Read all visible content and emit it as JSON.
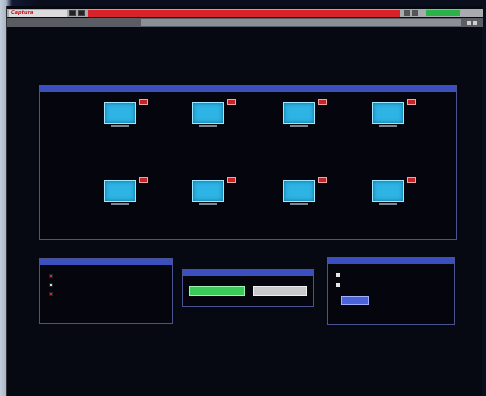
{
  "topbar": {
    "logo": "Captura",
    "alarms": [
      "",
      "",
      "",
      "",
      ""
    ],
    "green_indicator": ""
  },
  "subbar": {
    "left": "",
    "title": ""
  },
  "main_panel": {
    "title": "",
    "nodes": [
      {
        "label_line1": "",
        "label_line2": ""
      },
      {
        "label_line1": "",
        "label_line2": ""
      },
      {
        "label_line1": "",
        "label_line2": ""
      },
      {
        "label_line1": "",
        "label_line2": ""
      },
      {
        "label_line1": "",
        "label_line2": ""
      },
      {
        "label_line1": "",
        "label_line2": ""
      },
      {
        "label_line1": "",
        "label_line2": ""
      },
      {
        "label_line1": "",
        "label_line2": ""
      }
    ]
  },
  "status_panel": {
    "title": "",
    "rows": [
      {
        "label": "",
        "color": "#d8262d"
      },
      {
        "label": "",
        "color": "#d9d9d9"
      },
      {
        "label": "",
        "color": "#d8262d"
      }
    ]
  },
  "action_panel": {
    "title": "",
    "confirm_label": "",
    "cancel_label": ""
  },
  "options_panel": {
    "title": "",
    "options": [
      "",
      ""
    ],
    "timeout_label": "",
    "timeout_value": ""
  },
  "colors": {
    "panel_header": "#3c4fbf",
    "monitor": "#2db3e4",
    "alert": "#c7242a",
    "alarm_bar": "#d9232a",
    "ok_button": "#3bc95a"
  }
}
